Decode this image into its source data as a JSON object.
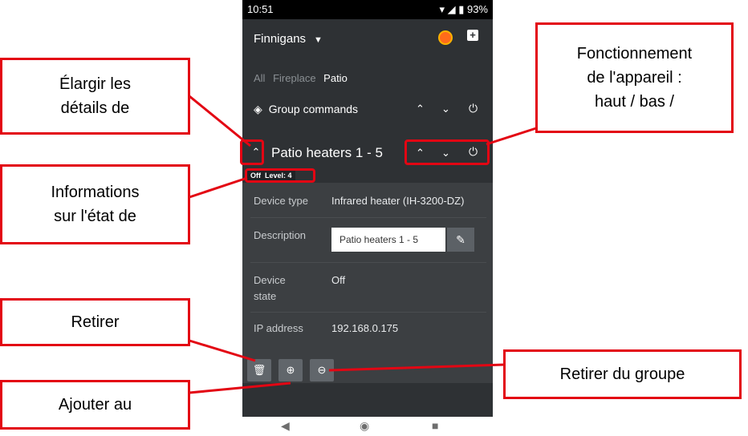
{
  "status": {
    "time": "10:51",
    "battery": "93%"
  },
  "header": {
    "title": "Finnigans"
  },
  "tabs": [
    {
      "label": "All"
    },
    {
      "label": "Fireplace"
    },
    {
      "label": "Patio"
    }
  ],
  "group": {
    "label": "Group commands"
  },
  "device": {
    "title": "Patio heaters 1 - 5",
    "badges": {
      "state": "Off",
      "level": "Level: 4"
    },
    "type_label": "Device type",
    "type_value": "Infrared heater (IH-3200-DZ)",
    "description_label": "Description",
    "description_value": "Patio heaters 1 - 5",
    "state_label_1": "Device",
    "state_label_2": "state",
    "state_value": "Off",
    "ip_label": "IP address",
    "ip_value": "192.168.0.175"
  },
  "callouts": {
    "expand_l1": "Élargir les",
    "expand_l2": "détails de",
    "status_l1": "Informations",
    "status_l2": "sur l'état de",
    "remove": "Retirer",
    "add_l1": "Ajouter au",
    "func_l1": "Fonctionnement",
    "func_l2": "de l'appareil :",
    "func_l3": "haut / bas /",
    "remove_group": "Retirer du groupe"
  },
  "accent": "#e30613"
}
